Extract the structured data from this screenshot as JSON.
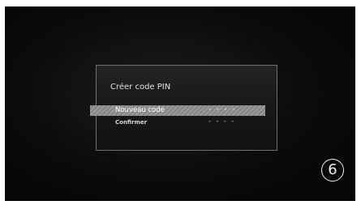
{
  "dialog": {
    "title": "Créer code PIN",
    "rows": [
      {
        "label": "Nouveau code",
        "value": "- - - -",
        "selected": true
      },
      {
        "label": "Confirmer",
        "value": "- - - -",
        "selected": false
      }
    ]
  },
  "step_badge": "6",
  "colors": {
    "background": "#0b0b0b",
    "dialog_border": "#6e6e6e",
    "selection": "#9a9a9a",
    "text": "#e2e2e2"
  }
}
